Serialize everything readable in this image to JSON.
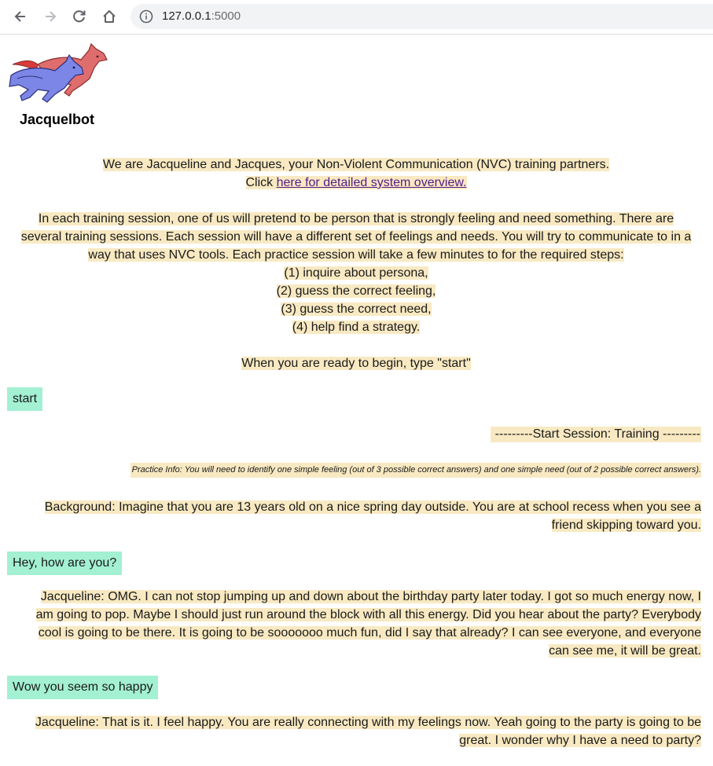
{
  "browser": {
    "url_host": "127.0.0.1",
    "url_port": ":5000"
  },
  "app": {
    "name": "Jacquelbot"
  },
  "intro": {
    "line1": "We are Jacqueline and Jacques, your Non-Violent Communication (NVC) training partners.",
    "click_prefix": "Click ",
    "overview_link": "here for detailed system overview.",
    "para2_l1": "In each training session, one of us will pretend to be person that is strongly feeling and need something. There are",
    "para2_l2": "several training sessions. Each session will have a different set of feelings and needs. You will try to communicate to in a",
    "para2_l3": "way that uses NVC tools. Each practice session will take a few minutes to for the required steps:",
    "step1": "(1) inquire about persona,",
    "step2": "(2) guess the correct feeling,",
    "step3": "(3) guess the correct need,",
    "step4": "(4) help find a strategy.",
    "ready": "When you are ready to begin, type \"start\""
  },
  "chat": {
    "user1": "start",
    "session_header": "---------Start Session: Training ---------",
    "practice_info": "Practice Info: You will need to identify one simple feeling (out of 3 possible correct answers) and one simple need (out of 2 possible correct answers).",
    "background_l1": "Background: Imagine that you are 13 years old on a nice spring day outside. You are at school recess when you see a",
    "background_l2": "friend skipping toward you.",
    "user2": "Hey, how are you?",
    "bot2_l1": "Jacqueline: OMG. I can not stop jumping up and down about the birthday party later today. I got so much energy now, I",
    "bot2_l2": "am going to pop. Maybe I should just run around the block with all this energy. Did you hear about the party? Everybody",
    "bot2_l3": "cool is going to be there. It is going to be sooooooo much fun, did I say that already? I can see everyone, and everyone",
    "bot2_l4": "can see me, it will be great.",
    "user3": "Wow you seem so happy",
    "bot3_l1": "Jacqueline: That is it. I feel happy. You are really connecting with my feelings now. Yeah going to the party is going to be",
    "bot3_l2": "great. I wonder why I have a need to party?"
  },
  "colors": {
    "bot_highlight": "#f8e9c2",
    "user_highlight": "#a3f0d3",
    "link": "#551a8b"
  },
  "icons": [
    "back-arrow-icon",
    "forward-arrow-icon",
    "reload-icon",
    "home-icon",
    "info-icon",
    "running-wolves-logo"
  ]
}
